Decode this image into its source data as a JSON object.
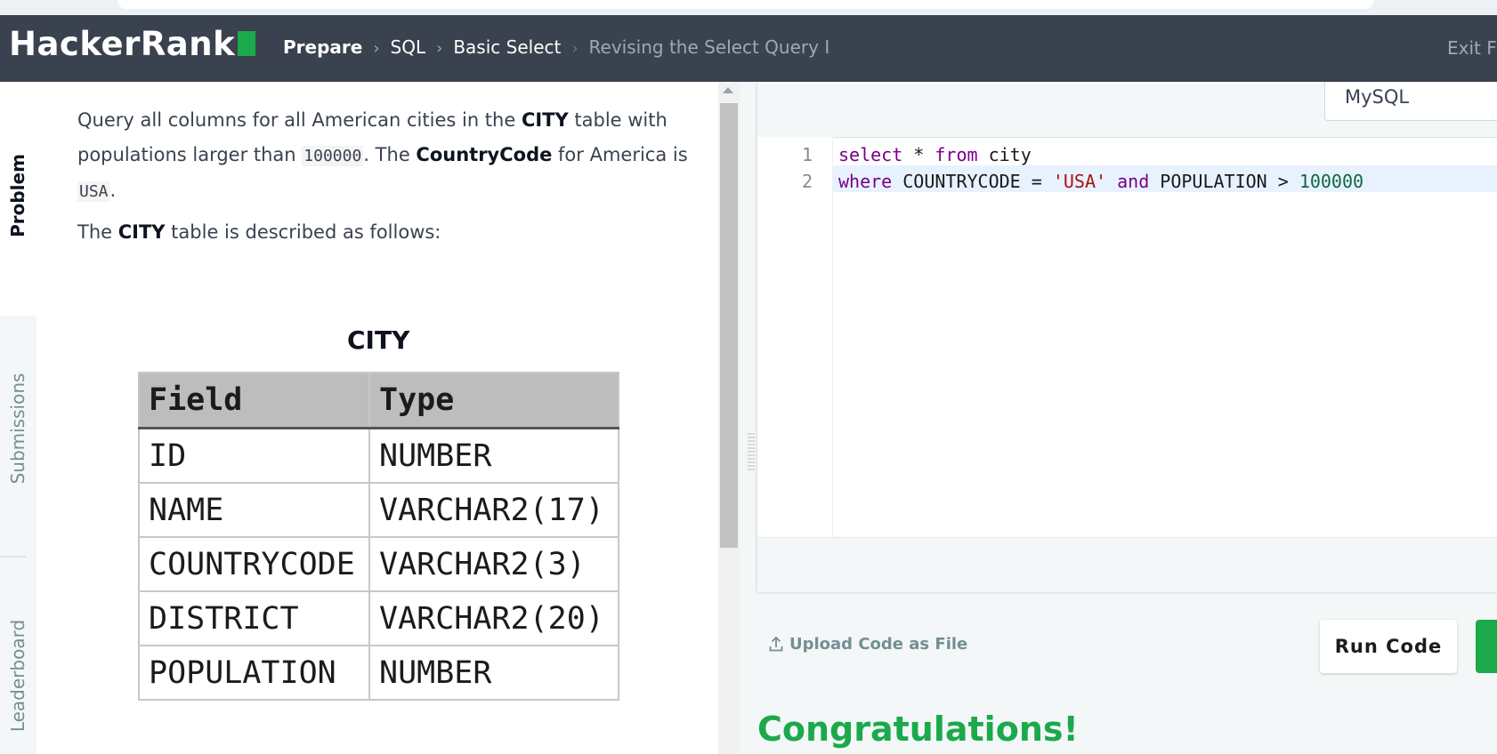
{
  "header": {
    "logo_text": "HackerRank",
    "breadcrumbs": [
      "Prepare",
      "SQL",
      "Basic Select",
      "Revising the Select Query I"
    ],
    "exit_label": "Exit Fu",
    "colors": {
      "navbar": "#39424e",
      "brand_green": "#1ba94c"
    }
  },
  "side_tabs": [
    "Problem",
    "Submissions",
    "Leaderboard"
  ],
  "problem": {
    "p1_a": "Query all columns for all American cities in the ",
    "p1_city": "CITY",
    "p1_b": " table with",
    "p2_a": "populations larger than ",
    "p2_num": "100000",
    "p2_b": ". The ",
    "p2_cc": "CountryCode",
    "p2_c": " for America is",
    "p3_usa": "USA",
    "p3_dot": ".",
    "p4_a": "The ",
    "p4_city": "CITY",
    "p4_b": " table is described as follows:",
    "table_title": "CITY",
    "table_headers": [
      "Field",
      "Type"
    ],
    "table_rows": [
      [
        "ID",
        "NUMBER"
      ],
      [
        "NAME",
        "VARCHAR2(17)"
      ],
      [
        "COUNTRYCODE",
        "VARCHAR2(3)"
      ],
      [
        "DISTRICT",
        "VARCHAR2(20)"
      ],
      [
        "POPULATION",
        "NUMBER"
      ]
    ]
  },
  "editor": {
    "language": "MySQL",
    "line_numbers": [
      "1",
      "2"
    ],
    "line1": {
      "kw1": "select",
      "mid": " * ",
      "kw2": "from",
      "rest": " city"
    },
    "line2": {
      "kw1": "where",
      "mid1": " COUNTRYCODE = ",
      "str": "'USA'",
      "sp": " ",
      "kw2": "and",
      "mid2": " POPULATION > ",
      "num": "100000"
    }
  },
  "actions": {
    "upload_label": "Upload Code as File",
    "run_label": "Run Code"
  },
  "result": {
    "message": "Congratulations!"
  }
}
